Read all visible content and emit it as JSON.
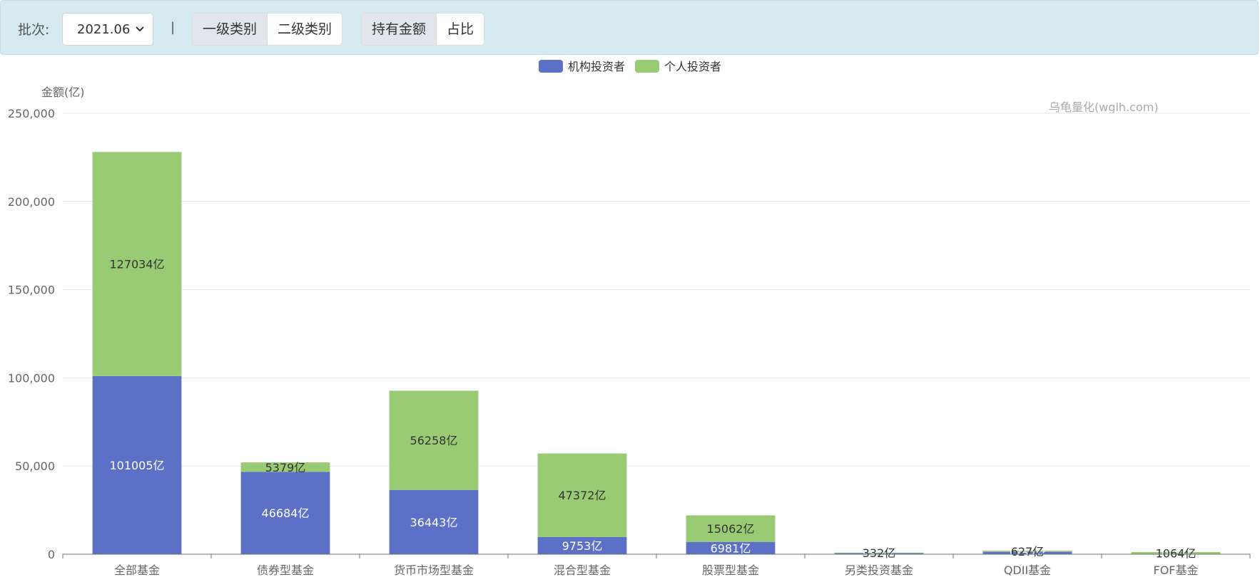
{
  "toolbar": {
    "batch_label": "批次:",
    "batch_value": "2021.06",
    "separator": "|",
    "category_buttons": [
      {
        "label": "一级类别",
        "active": true
      },
      {
        "label": "二级类别",
        "active": false
      }
    ],
    "metric_buttons": [
      {
        "label": "持有金额",
        "active": true
      },
      {
        "label": "占比",
        "active": false
      }
    ]
  },
  "watermark": "乌龟量化(wglh.com)",
  "chart_data": {
    "type": "bar",
    "stacked": true,
    "ylabel": "金额(亿)",
    "ylim": [
      0,
      250000
    ],
    "yticks": [
      0,
      50000,
      100000,
      150000,
      200000,
      250000
    ],
    "ytick_labels": [
      "0",
      "50,000",
      "100,000",
      "150,000",
      "200,000",
      "250,000"
    ],
    "grid": true,
    "legend_position": "top-center",
    "label_suffix": "亿",
    "categories": [
      "全部基金",
      "债券型基金",
      "货币市场型基金",
      "混合型基金",
      "股票型基金",
      "另类投资基金",
      "QDII基金",
      "FOF基金"
    ],
    "series": [
      {
        "name": "机构投资者",
        "color": "#5b70c6",
        "label_color": "#ffffff",
        "values": [
          101005,
          46684,
          36443,
          9753,
          6981,
          582,
          1352,
          164
        ]
      },
      {
        "name": "个人投资者",
        "color": "#98cb73",
        "label_color": "#333333",
        "values": [
          127034,
          5379,
          56258,
          47372,
          15062,
          332,
          627,
          1064
        ]
      }
    ]
  }
}
